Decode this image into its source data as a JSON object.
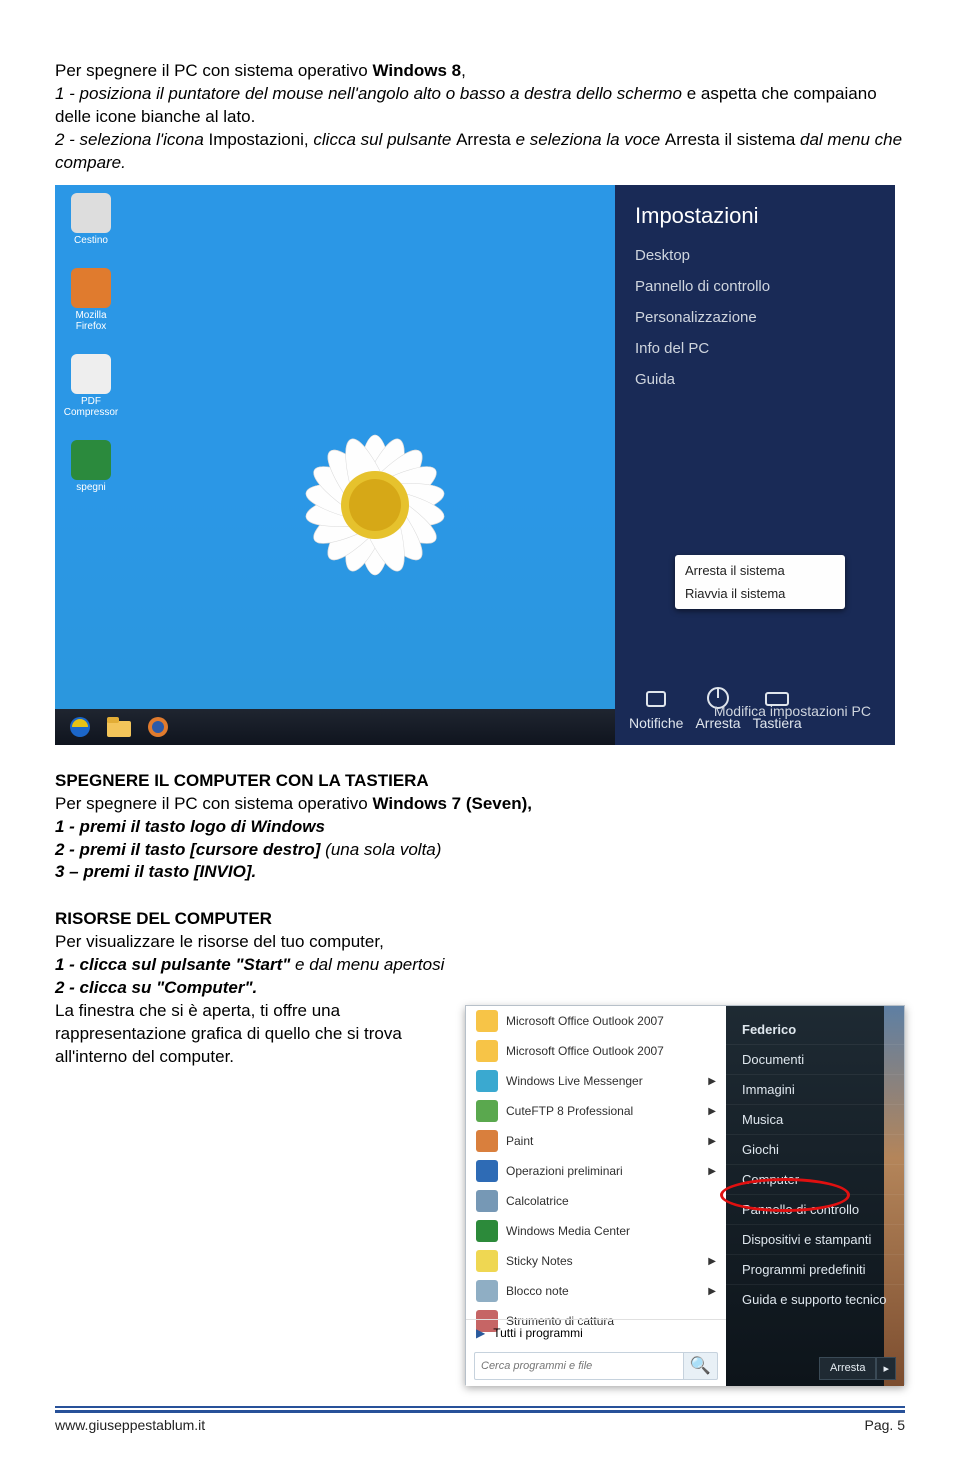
{
  "intro": {
    "line1a": "Per spegnere il PC con sistema operativo ",
    "win8": "Windows 8",
    "line1b": ",",
    "step1a": "1 - posiziona il puntatore del mouse nell'angolo alto o basso a destra dello schermo",
    "step1b": " e aspetta che compaiano delle icone bianche al lato.",
    "step2a": "2 - seleziona l'icona ",
    "step2i": "Impostazioni, ",
    "step2b": "clicca sul pulsante ",
    "step2c": "Arresta",
    "step2d": " e seleziona la voce ",
    "step2e": "Arresta il sistema ",
    "step2f": "dal menu che compare."
  },
  "fig1": {
    "panel_title": "Impostazioni",
    "items": [
      "Desktop",
      "Pannello di controllo",
      "Personalizzazione",
      "Info del PC",
      "Guida"
    ],
    "popup": [
      "Arresta il sistema",
      "Riavvia il sistema"
    ],
    "bottom_icons": {
      "a": "Notifiche",
      "b": "Arresta",
      "c": "Tastiera"
    },
    "modify": "Modifica impostazioni PC",
    "desktop_icons": [
      "Cestino",
      "Mozilla Firefox",
      "PDF Compressor",
      "spegni"
    ]
  },
  "section2": {
    "title": "SPEGNERE IL COMPUTER CON LA TASTIERA",
    "l1a": "Per spegnere il PC con sistema operativo ",
    "l1b": "Windows 7 (Seven),",
    "s1": "1 - premi il tasto logo di Windows",
    "s2a": "2 - premi il tasto [cursore destro]",
    "s2b": " (una sola volta)",
    "s3": "3 – premi il tasto [INVIO]."
  },
  "section3": {
    "title": "RISORSE DEL COMPUTER",
    "l1": "Per visualizzare le risorse del tuo computer,",
    "s1a": "1 - clicca sul pulsante \"Start\"",
    "s1b": " e dal menu apertosi",
    "s2": "2 - clicca su \"Computer\".",
    "l2": "La finestra che si è aperta, ti offre una rappresentazione grafica di quello che si trova all'interno del computer."
  },
  "fig2": {
    "left_items": [
      {
        "label": "Microsoft Office Outlook 2007",
        "color": "#f7c447"
      },
      {
        "label": "Microsoft Office Outlook 2007",
        "color": "#f7c447"
      },
      {
        "label": "Windows Live Messenger",
        "color": "#3aa9d0",
        "arrow": true
      },
      {
        "label": "CuteFTP 8 Professional",
        "color": "#5aa84e",
        "arrow": true
      },
      {
        "label": "Paint",
        "color": "#d97f3d",
        "arrow": true
      },
      {
        "label": "Operazioni preliminari",
        "color": "#2e6bb5",
        "arrow": true
      },
      {
        "label": "Calcolatrice",
        "color": "#7698b5"
      },
      {
        "label": "Windows Media Center",
        "color": "#2c8a3a"
      },
      {
        "label": "Sticky Notes",
        "color": "#efd752",
        "arrow": true
      },
      {
        "label": "Blocco note",
        "color": "#8faec4",
        "arrow": true
      },
      {
        "label": "Strumento di cattura",
        "color": "#c66565"
      }
    ],
    "all_programs": "Tutti i programmi",
    "search_placeholder": "Cerca programmi e file",
    "right_user": "Federico",
    "right_items": [
      "Documenti",
      "Immagini",
      "Musica",
      "Giochi",
      "Computer",
      "Pannello di controllo",
      "Dispositivi e stampanti",
      "Programmi predefiniti",
      "Guida e supporto tecnico"
    ],
    "arresta": "Arresta"
  },
  "footer": {
    "site": "www.giuseppestablum.it",
    "page": "Pag. 5"
  }
}
